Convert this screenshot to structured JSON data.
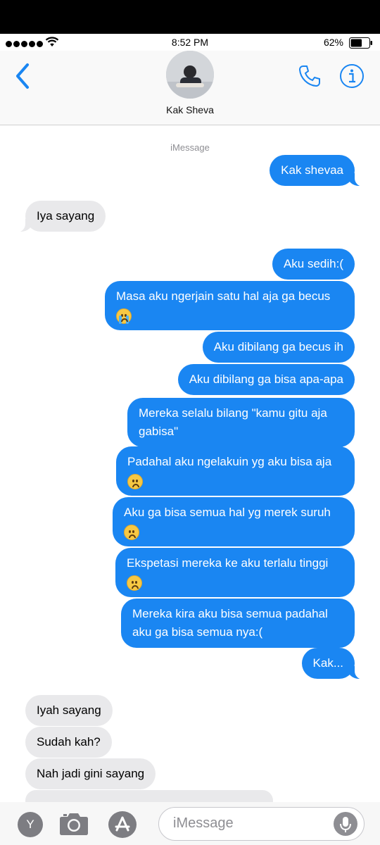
{
  "status_bar": {
    "time": "8:52 PM",
    "battery_percent": "62%",
    "battery_level": 0.62,
    "icons": [
      "signal-dots-icon",
      "wifi-icon",
      "battery-icon"
    ]
  },
  "header": {
    "contact_name": "Kak Sheva",
    "icons": [
      "back-chevron-icon",
      "phone-icon",
      "info-icon"
    ]
  },
  "thread": {
    "service_label": "iMessage",
    "messages": [
      {
        "from": "me",
        "text": "Kak shevaa"
      },
      {
        "from": "them",
        "text": "Iya sayang"
      },
      {
        "from": "me",
        "text": "Aku sedih:("
      },
      {
        "from": "me",
        "text": "Masa aku ngerjain satu hal aja ga becus",
        "emoji": "loudly-crying-face"
      },
      {
        "from": "me",
        "text": "Aku dibilang ga becus ih"
      },
      {
        "from": "me",
        "text": "Aku dibilang ga bisa apa-apa"
      },
      {
        "from": "me",
        "text": "Mereka selalu bilang \"kamu gitu aja\ngabisa\""
      },
      {
        "from": "me",
        "text": "Padahal aku ngelakuin yg aku bisa aja",
        "emoji": "frowning-face"
      },
      {
        "from": "me",
        "text": "Aku ga bisa semua hal yg merek suruh",
        "emoji": "disappointed-face"
      },
      {
        "from": "me",
        "text": "Ekspetasi mereka ke aku terlalu tinggi",
        "emoji": "frowning-face"
      },
      {
        "from": "me",
        "text": "Mereka kira aku bisa semua padahal\naku ga bisa semua nya:("
      },
      {
        "from": "me",
        "text": "Kak..."
      },
      {
        "from": "them",
        "text": "Iyah sayang"
      },
      {
        "from": "them",
        "text": "Sudah kah?"
      },
      {
        "from": "them",
        "text": "Nah jadi gini sayang"
      }
    ]
  },
  "input_bar": {
    "apps_label": "Y",
    "placeholder": "iMessage",
    "icons": [
      "camera-icon",
      "app-store-icon",
      "microphone-icon"
    ]
  }
}
